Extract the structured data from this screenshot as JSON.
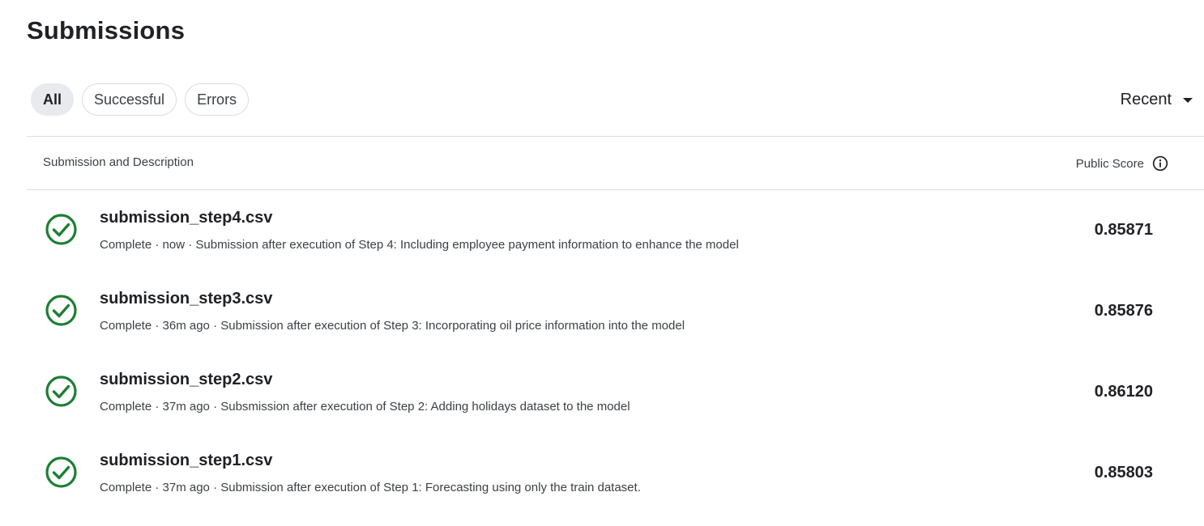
{
  "page": {
    "title": "Submissions"
  },
  "filters": [
    {
      "label": "All",
      "active": true
    },
    {
      "label": "Successful",
      "active": false
    },
    {
      "label": "Errors",
      "active": false
    }
  ],
  "sort": {
    "label": "Recent",
    "icon": "caret-down-icon"
  },
  "table": {
    "headers": {
      "left": "Submission and Description",
      "right": "Public Score",
      "right_icon": "info-icon"
    },
    "rows": [
      {
        "file": "submission_step4.csv",
        "description": "Complete · now · Submission after execution of Step 4: Including employee payment information to enhance the model",
        "score": "0.85871",
        "status_icon": "check-circle-icon"
      },
      {
        "file": "submission_step3.csv",
        "description": "Complete · 36m ago · Submission after execution of Step 3: Incorporating oil price information into the model",
        "score": "0.85876",
        "status_icon": "check-circle-icon"
      },
      {
        "file": "submission_step2.csv",
        "description": "Complete · 37m ago · Subsmission after execution of Step 2: Adding holidays dataset to the model",
        "score": "0.86120",
        "status_icon": "check-circle-icon"
      },
      {
        "file": "submission_step1.csv",
        "description": "Complete · 37m ago · Submission after execution of Step 1: Forecasting using only the train dataset.",
        "score": "0.85803",
        "status_icon": "check-circle-icon"
      }
    ]
  },
  "colors": {
    "success": "#1e7e34",
    "divider": "#dadce0",
    "active_chip_bg": "#e8eaed"
  }
}
